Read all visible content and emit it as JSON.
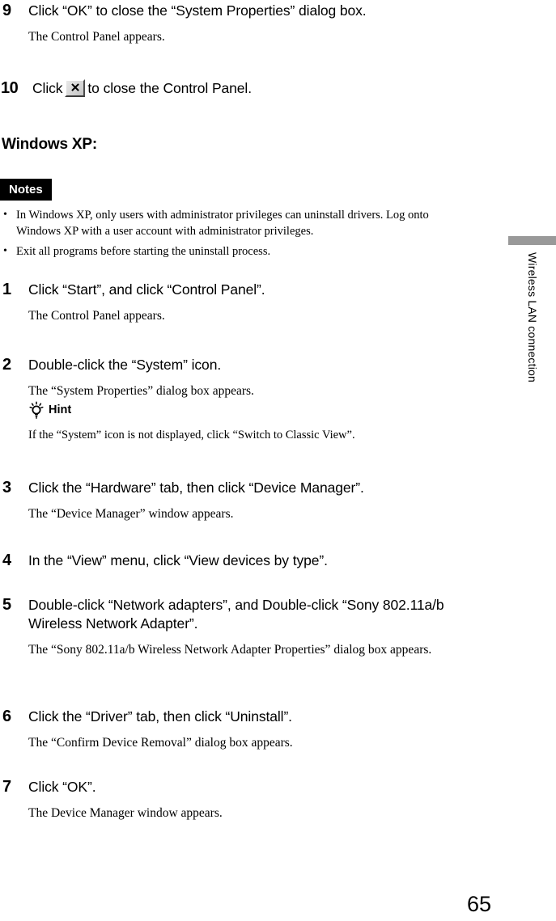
{
  "page": {
    "number": "65",
    "side_tab_label": "Wireless LAN connection",
    "side_tab_color": "#999999"
  },
  "continued_steps": [
    {
      "number": "9",
      "heading": "Click “OK” to close the “System Properties” dialog box.",
      "body": "The Control Panel appears."
    }
  ],
  "step10": {
    "number": "10",
    "text_before": "Click",
    "icon_label": "close-button",
    "icon_glyph": "✕",
    "text_after": "to close the Control Panel."
  },
  "section": {
    "heading": "Windows XP:"
  },
  "notes": {
    "badge": "Notes",
    "items": [
      "In Windows XP, only users with administrator privileges can uninstall drivers. Log onto Windows XP with a user account with administrator privileges.",
      "Exit all programs before starting the uninstall process."
    ]
  },
  "steps": [
    {
      "number": "1",
      "heading": "Click “Start”, and click “Control Panel”.",
      "body": "The Control Panel appears."
    },
    {
      "number": "2",
      "heading": "Double-click the “System” icon.",
      "body": "The “System Properties” dialog box appears.",
      "hint_label": "Hint",
      "hint_text": "If the “System” icon is not displayed, click “Switch to Classic View”."
    },
    {
      "number": "3",
      "heading": "Click the “Hardware” tab, then click “Device Manager”.",
      "body": "The “Device Manager” window appears."
    },
    {
      "number": "4",
      "heading": "In the “View” menu, click “View devices by type”.",
      "body": ""
    },
    {
      "number": "5",
      "heading": "Double-click “Network adapters”, and Double-click “Sony 802.11a/b Wireless Network Adapter”.",
      "body": "The “Sony 802.11a/b Wireless Network Adapter Properties” dialog box appears."
    },
    {
      "number": "6",
      "heading": "Click the “Driver” tab, then click “Uninstall”.",
      "body": "The “Confirm Device Removal” dialog box appears."
    },
    {
      "number": "7",
      "heading": "Click “OK”.",
      "body": "The Device Manager window appears."
    }
  ]
}
